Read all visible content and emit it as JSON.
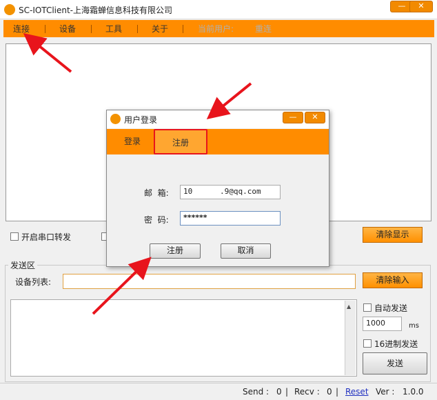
{
  "window": {
    "title": "SC-IOTClient-上海霜蝉信息科技有限公司",
    "minimize": "—",
    "close": "✕"
  },
  "menu": {
    "items": [
      "连接",
      "设备",
      "工具",
      "关于"
    ],
    "current_user_label": "当前用户:",
    "reconnect": "重连"
  },
  "options": {
    "serial_forward": "开启串口转发",
    "clear_display": "清除显示"
  },
  "send_area": {
    "group_title": "发送区",
    "device_list_label": "设备列表:",
    "clear_input": "清除输入",
    "auto_send": "自动发送",
    "interval_value": "1000",
    "interval_unit": "ms",
    "hex_send": "16进制发送",
    "send_button": "发送"
  },
  "status": {
    "send_label": "Send :",
    "send_value": "0",
    "recv_label": "Recv :",
    "recv_value": "0",
    "reset_link": "Reset",
    "version_label": "Ver :",
    "version_value": "1.0.0"
  },
  "dialog": {
    "title": "用户登录",
    "minimize": "—",
    "close": "✕",
    "tabs": [
      "登录",
      "注册"
    ],
    "active_tab": "注册",
    "email_label": "邮  箱:",
    "email_value": "10      .9@qq.com",
    "password_label": "密  码:",
    "password_value": "******",
    "register_button": "注册",
    "cancel_button": "取消"
  },
  "colors": {
    "accent": "#ff8c00",
    "annotation": "#e8141c"
  }
}
